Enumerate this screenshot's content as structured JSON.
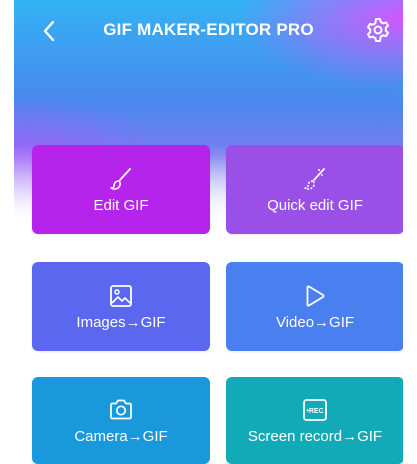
{
  "header": {
    "title": "GIF MAKER-EDITOR PRO",
    "back_icon": "chevron-left-icon",
    "settings_icon": "gear-icon"
  },
  "tiles": [
    {
      "label": "Edit GIF",
      "icon": "brush-icon",
      "color": "#b624ec"
    },
    {
      "label": "Quick edit GIF",
      "icon": "magic-brush-icon",
      "color": "#9a4fe6"
    },
    {
      "label": "Images→GIF",
      "icon": "image-icon",
      "color": "#5a67ee"
    },
    {
      "label": "Video→GIF",
      "icon": "play-icon",
      "color": "#4a7ff0"
    },
    {
      "label": "Camera→GIF",
      "icon": "camera-icon",
      "color": "#1a98dc"
    },
    {
      "label": "Screen record→GIF",
      "icon": "rec-icon",
      "icon_text": "•REC",
      "color": "#12aab6"
    }
  ],
  "colors": {
    "accent_pink": "#ec48ff",
    "accent_blue": "#33b2f4"
  }
}
